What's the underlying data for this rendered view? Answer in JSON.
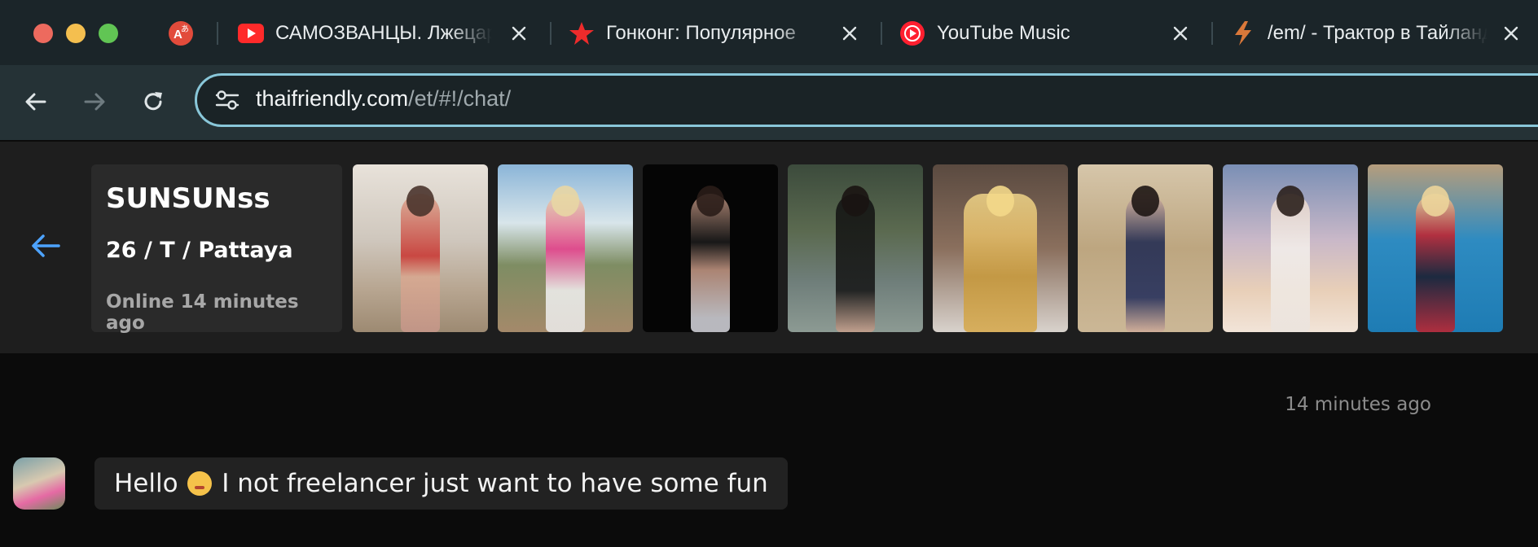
{
  "tabs": [
    {
      "title": "",
      "icon": "translate-icon"
    },
    {
      "title": "САМОЗВАНЦЫ. Лжецарь",
      "icon": "youtube-icon"
    },
    {
      "title": "Гонконг: Популярное",
      "icon": "star-icon"
    },
    {
      "title": "YouTube Music",
      "icon": "youtube-music-icon"
    },
    {
      "title": "/em/ - Трактор в Тайланд",
      "icon": "lightning-icon"
    }
  ],
  "address_bar": {
    "host": "thaifriendly.com",
    "path": "/et/#!/chat/"
  },
  "profile": {
    "name": "SUNSUNss",
    "meta": "26 / T / Pattaya",
    "online_status": "Online 14 minutes ago",
    "photo_count": 8
  },
  "chat": {
    "timestamp": "14 minutes ago",
    "message_part1": "Hello ",
    "message_emoji": "kissing-face-emoji",
    "message_part2": " I not freelancer just want to have some fun"
  },
  "colors": {
    "accent_blue": "#4da3ff",
    "omnibox_border": "#89c7d9"
  }
}
